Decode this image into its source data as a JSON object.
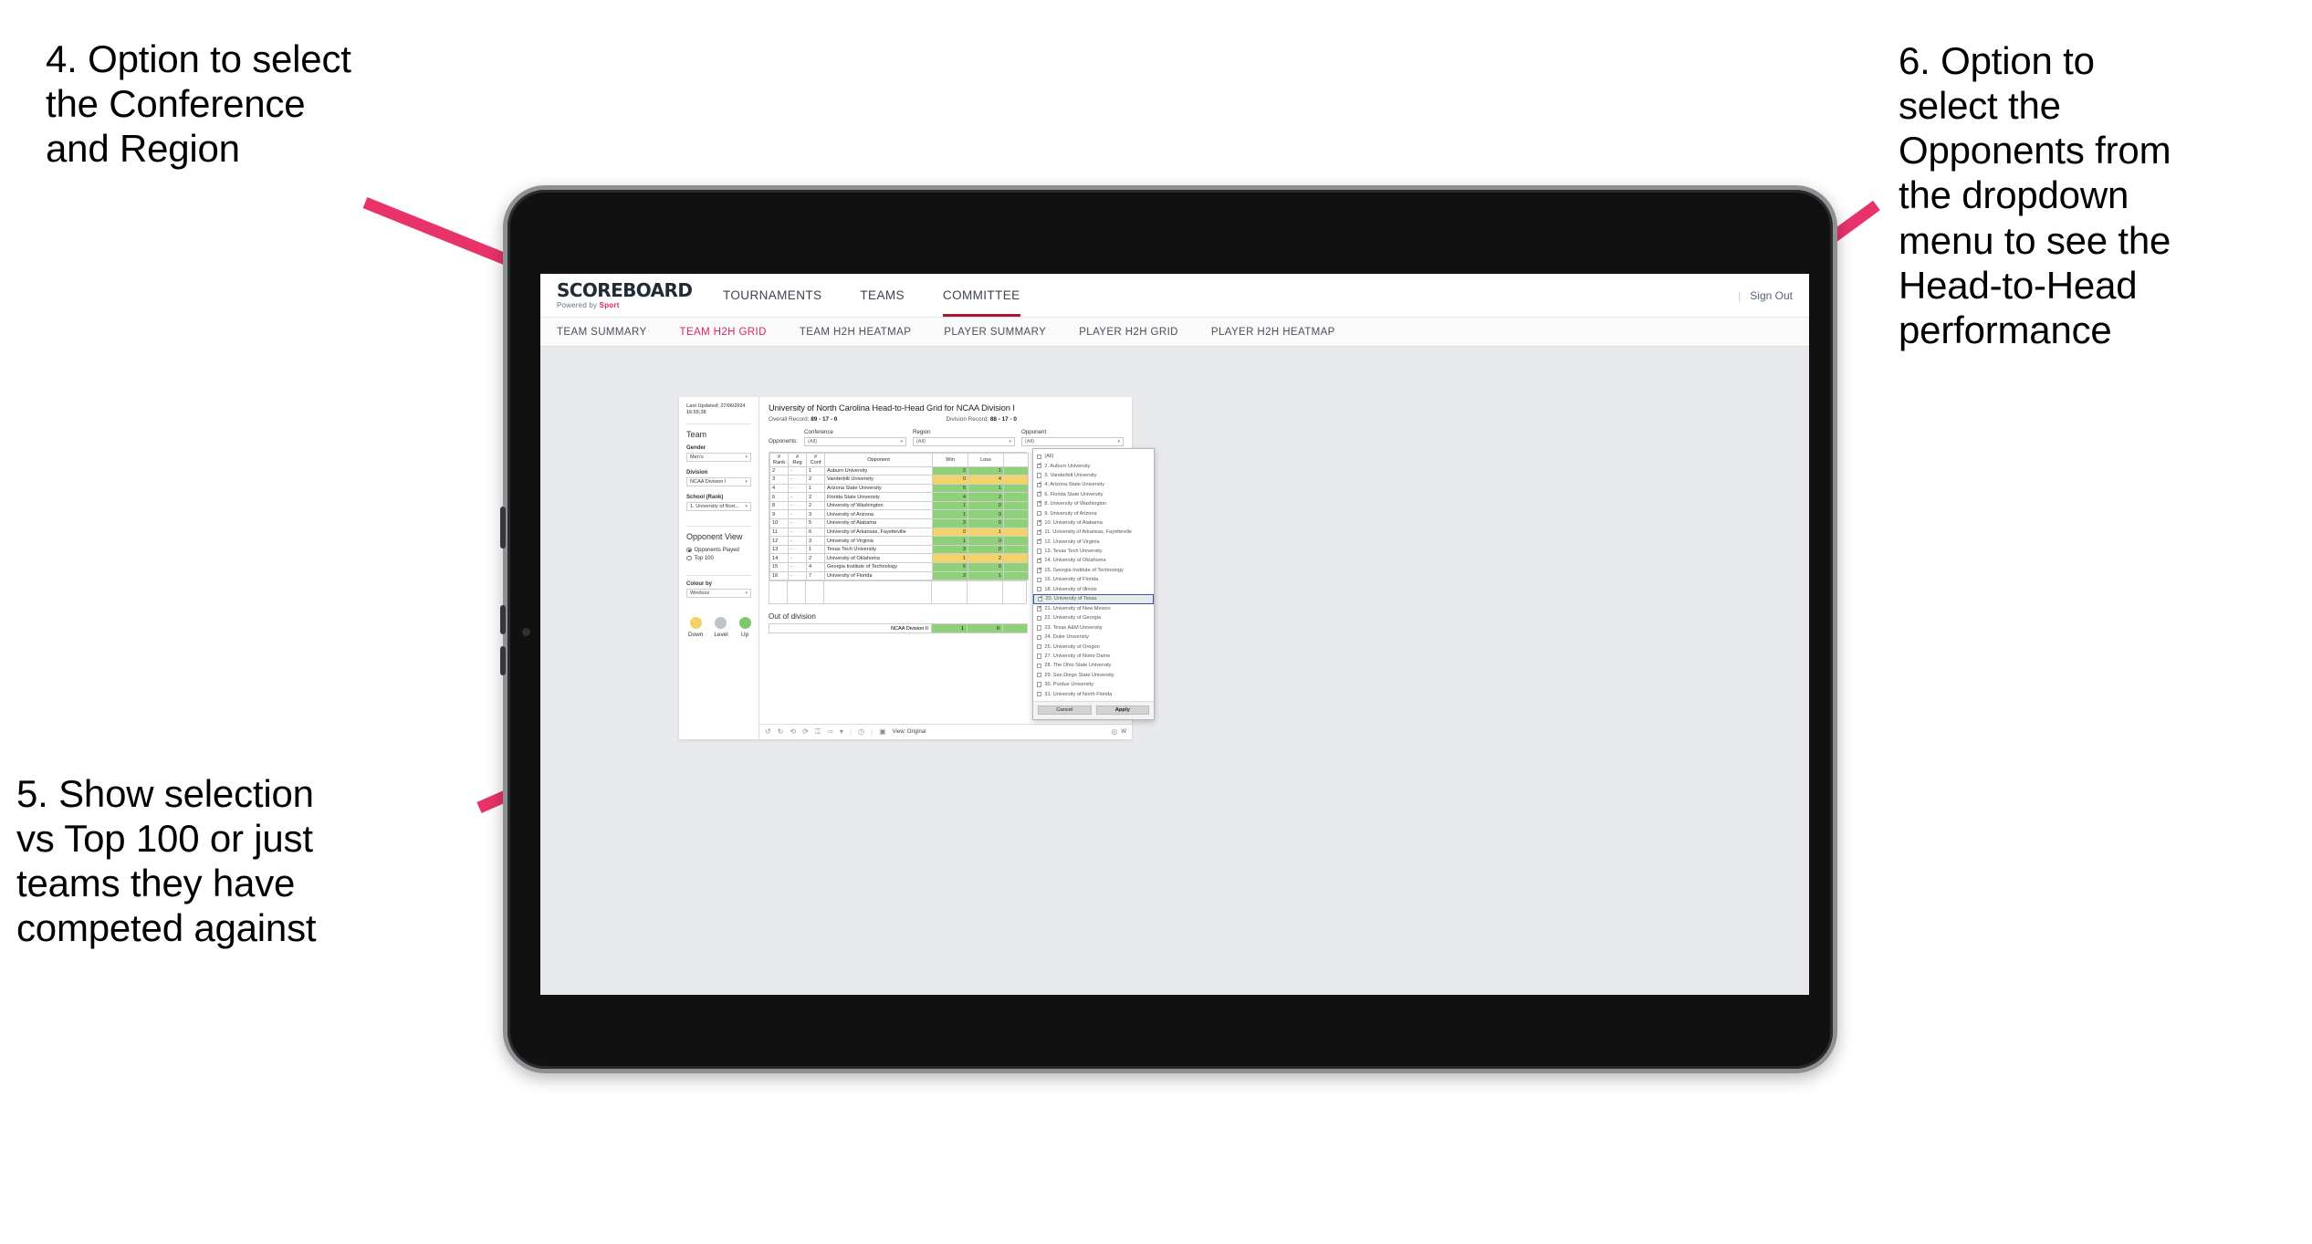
{
  "annotations": {
    "note4": "4. Option to select\nthe Conference\nand Region",
    "note5": "5. Show selection\nvs Top 100 or just\nteams they have\ncompeted against",
    "note6": "6. Option to\nselect the\nOpponents from\nthe dropdown\nmenu to see the\nHead-to-Head\nperformance"
  },
  "accent": "#e1245f",
  "app": {
    "brand_main": "SCOREBOARD",
    "brand_sub_prefix": "Powered by ",
    "brand_sub_accent": "Sport",
    "nav": [
      {
        "label": "TOURNAMENTS",
        "active": false
      },
      {
        "label": "TEAMS",
        "active": false
      },
      {
        "label": "COMMITTEE",
        "active": true
      }
    ],
    "sign_out": "Sign Out",
    "sep": "|",
    "subnav": [
      {
        "label": "TEAM SUMMARY",
        "active": false
      },
      {
        "label": "TEAM H2H GRID",
        "active": true
      },
      {
        "label": "TEAM H2H HEATMAP",
        "active": false
      },
      {
        "label": "PLAYER SUMMARY",
        "active": false
      },
      {
        "label": "PLAYER H2H GRID",
        "active": false
      },
      {
        "label": "PLAYER H2H HEATMAP",
        "active": false
      }
    ]
  },
  "sidebar": {
    "last_updated_line1": "Last Updated: 27/06/2024",
    "last_updated_line2": "16:55:38",
    "team_title": "Team",
    "gender_label": "Gender",
    "gender_value": "Men's",
    "division_label": "Division",
    "division_value": "NCAA Division I",
    "school_label": "School (Rank)",
    "school_value": "1. University of Nort...",
    "opponent_view_title": "Opponent View",
    "radio_played": "Opponents Played",
    "radio_top100": "Top 100",
    "radio_selected": "Opponents Played",
    "colour_by_label": "Colour by",
    "colour_by_value": "Win/loss",
    "legend": [
      {
        "label": "Down",
        "color": "#f2d269"
      },
      {
        "label": "Level",
        "color": "#bfc3c7"
      },
      {
        "label": "Up",
        "color": "#7dc96a"
      }
    ]
  },
  "viz": {
    "title": "University of North Carolina Head-to-Head Grid for NCAA Division I",
    "overall_record_label": "Overall Record:",
    "overall_record_value": "89 - 17 - 0",
    "division_record_label": "Division Record:",
    "division_record_value": "88 - 17 - 0",
    "opponents_label": "Opponents:",
    "filters": [
      {
        "caption": "Conference",
        "value": "(All)"
      },
      {
        "caption": "Region",
        "value": "(All)"
      },
      {
        "caption": "Opponent",
        "value": "(All)"
      }
    ],
    "out_of_division_title": "Out of division",
    "out_of_division_row": {
      "label": "NCAA Division II",
      "win": "1",
      "loss": "0"
    }
  },
  "chart_data": {
    "type": "table",
    "title": "University of North Carolina Head-to-Head Grid for NCAA Division I",
    "columns": [
      "# Rank",
      "# Reg",
      "# Conf",
      "Opponent",
      "Win",
      "Loss"
    ],
    "column_headers_split": [
      {
        "l1": "#",
        "l2": "Rank"
      },
      {
        "l1": "#",
        "l2": "Reg"
      },
      {
        "l1": "#",
        "l2": "Conf"
      },
      {
        "l1": "",
        "l2": "Opponent"
      },
      {
        "l1": "",
        "l2": "Win"
      },
      {
        "l1": "",
        "l2": "Loss"
      }
    ],
    "rows": [
      {
        "rank": "2",
        "reg": "-",
        "conf": "1",
        "opponent": "Auburn University",
        "win": "2",
        "loss": "1",
        "state": "up"
      },
      {
        "rank": "3",
        "reg": "-",
        "conf": "2",
        "opponent": "Vanderbilt University",
        "win": "0",
        "loss": "4",
        "state": "down"
      },
      {
        "rank": "4",
        "reg": "-",
        "conf": "1",
        "opponent": "Arizona State University",
        "win": "5",
        "loss": "1",
        "state": "up"
      },
      {
        "rank": "6",
        "reg": "-",
        "conf": "2",
        "opponent": "Florida State University",
        "win": "4",
        "loss": "2",
        "state": "up"
      },
      {
        "rank": "8",
        "reg": "-",
        "conf": "2",
        "opponent": "University of Washington",
        "win": "1",
        "loss": "0",
        "state": "up"
      },
      {
        "rank": "9",
        "reg": "-",
        "conf": "3",
        "opponent": "University of Arizona",
        "win": "1",
        "loss": "0",
        "state": "up"
      },
      {
        "rank": "10",
        "reg": "-",
        "conf": "5",
        "opponent": "University of Alabama",
        "win": "3",
        "loss": "0",
        "state": "up"
      },
      {
        "rank": "11",
        "reg": "-",
        "conf": "6",
        "opponent": "University of Arkansas, Fayetteville",
        "win": "0",
        "loss": "1",
        "state": "down"
      },
      {
        "rank": "12",
        "reg": "-",
        "conf": "3",
        "opponent": "University of Virginia",
        "win": "1",
        "loss": "0",
        "state": "up"
      },
      {
        "rank": "13",
        "reg": "-",
        "conf": "1",
        "opponent": "Texas Tech University",
        "win": "3",
        "loss": "0",
        "state": "up"
      },
      {
        "rank": "14",
        "reg": "-",
        "conf": "2",
        "opponent": "University of Oklahoma",
        "win": "1",
        "loss": "2",
        "state": "down"
      },
      {
        "rank": "15",
        "reg": "-",
        "conf": "4",
        "opponent": "Georgia Institute of Technology",
        "win": "5",
        "loss": "0",
        "state": "up"
      },
      {
        "rank": "16",
        "reg": "-",
        "conf": "7",
        "opponent": "University of Florida",
        "win": "3",
        "loss": "1",
        "state": "up"
      }
    ],
    "out_of_division": {
      "label": "NCAA Division II",
      "win": 1,
      "loss": 0
    },
    "colors": {
      "up": "#8ed17a",
      "down": "#f2d269",
      "level": "#bfc3c7"
    }
  },
  "opponent_dropdown": {
    "options": [
      {
        "label": "(All)",
        "checked": false,
        "highlighted": false
      },
      {
        "label": "2. Auburn University",
        "checked": true,
        "highlighted": false
      },
      {
        "label": "3. Vanderbilt University",
        "checked": false,
        "highlighted": false
      },
      {
        "label": "4. Arizona State University",
        "checked": true,
        "highlighted": false
      },
      {
        "label": "6. Florida State University",
        "checked": true,
        "highlighted": false
      },
      {
        "label": "8. University of Washington",
        "checked": true,
        "highlighted": false
      },
      {
        "label": "9. University of Arizona",
        "checked": false,
        "highlighted": false
      },
      {
        "label": "10. University of Alabama",
        "checked": true,
        "highlighted": false
      },
      {
        "label": "11. University of Arkansas, Fayetteville",
        "checked": true,
        "highlighted": false
      },
      {
        "label": "12. University of Virginia",
        "checked": true,
        "highlighted": false
      },
      {
        "label": "13. Texas Tech University",
        "checked": false,
        "highlighted": false
      },
      {
        "label": "14. University of Oklahoma",
        "checked": true,
        "highlighted": false
      },
      {
        "label": "15. Georgia Institute of Technology",
        "checked": true,
        "highlighted": false
      },
      {
        "label": "16. University of Florida",
        "checked": false,
        "highlighted": false
      },
      {
        "label": "18. University of Illinois",
        "checked": false,
        "highlighted": false
      },
      {
        "label": "20. University of Texas",
        "checked": true,
        "highlighted": true
      },
      {
        "label": "21. University of New Mexico",
        "checked": true,
        "highlighted": false
      },
      {
        "label": "22. University of Georgia",
        "checked": false,
        "highlighted": false
      },
      {
        "label": "23. Texas A&M University",
        "checked": false,
        "highlighted": false
      },
      {
        "label": "24. Duke University",
        "checked": false,
        "highlighted": false
      },
      {
        "label": "25. University of Oregon",
        "checked": false,
        "highlighted": false
      },
      {
        "label": "27. University of Notre Dame",
        "checked": false,
        "highlighted": false
      },
      {
        "label": "28. The Ohio State University",
        "checked": false,
        "highlighted": false
      },
      {
        "label": "29. San Diego State University",
        "checked": false,
        "highlighted": false
      },
      {
        "label": "30. Purdue University",
        "checked": false,
        "highlighted": false
      },
      {
        "label": "31. University of North Florida",
        "checked": false,
        "highlighted": false
      }
    ],
    "cancel_label": "Cancel",
    "apply_label": "Apply"
  },
  "toolbar": {
    "view_label": "View: Original",
    "right_label": "W",
    "icons": [
      "undo-icon",
      "redo-icon",
      "revert-icon",
      "refresh-data-icon",
      "pause-data-icon",
      "share-icon",
      "dropdown-caret-icon",
      "history-icon",
      "view-icon"
    ]
  }
}
